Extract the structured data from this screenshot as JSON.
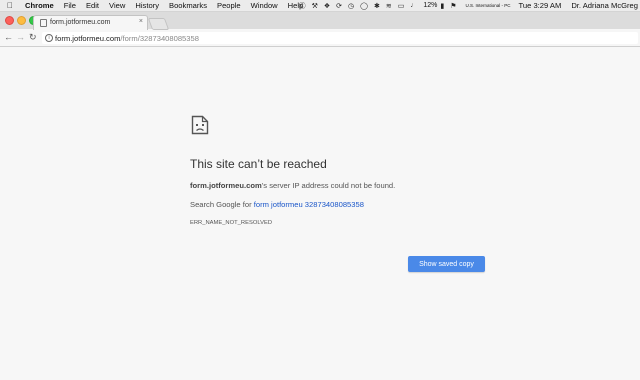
{
  "menubar": {
    "apple_icon": "apple-logo-icon",
    "items": [
      "Chrome",
      "File",
      "Edit",
      "View",
      "History",
      "Bookmarks",
      "People",
      "Window",
      "Help"
    ],
    "status": {
      "icons": [
        "skype-icon",
        "tool-icon",
        "dropbox-icon",
        "sync-icon",
        "time-machine-icon",
        "chat-icon",
        "bluetooth-icon",
        "wifi-icon",
        "airplay-icon",
        "volume-icon"
      ],
      "battery_text": "12%",
      "keyboard_layout": "U.S. International - PC",
      "clock": "Tue 3:29 AM",
      "user": "Dr. Adriana McGreg"
    }
  },
  "tab": {
    "title": "form.jotformeu.com",
    "close_glyph": "×"
  },
  "address_bar": {
    "host": "form.jotformeu.com",
    "path": "/form/32873408085358"
  },
  "error_page": {
    "title": "This site can’t be reached",
    "desc_host": "form.jotformeu.com",
    "desc_rest": "’s server IP address could not be found.",
    "search_prefix": "Search Google for ",
    "search_link": "form jotformeu 32873408085358",
    "error_code": "ERR_NAME_NOT_RESOLVED",
    "button_label": "Show saved copy"
  },
  "colors": {
    "accent_button": "#4a89e8",
    "link": "#1a56c9"
  }
}
